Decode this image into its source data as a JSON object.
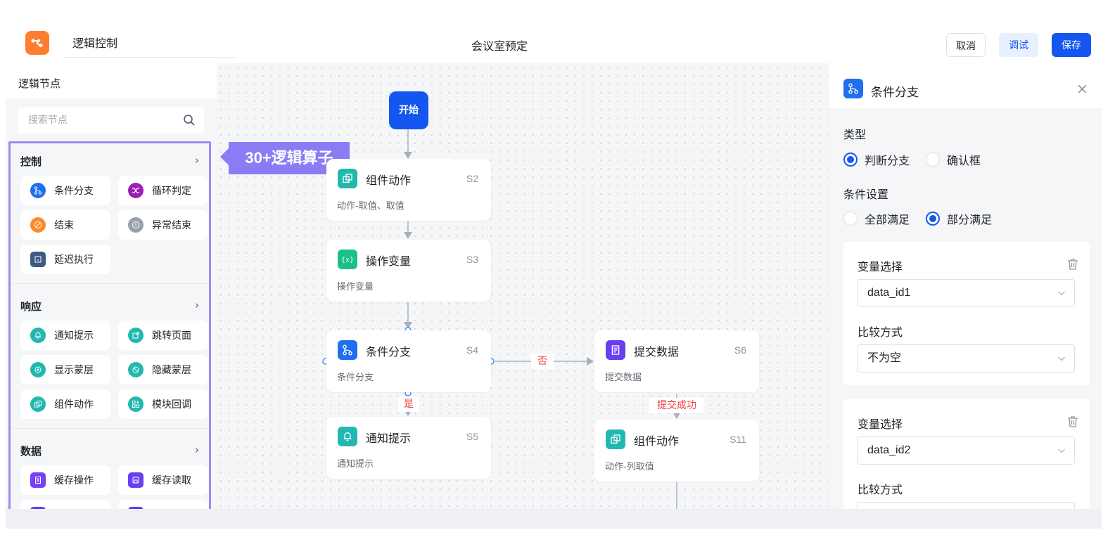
{
  "header": {
    "app_title": "逻辑控制",
    "page_title": "会议室预定",
    "buttons": {
      "cancel": "取消",
      "debug": "调试",
      "save": "保存"
    }
  },
  "sidebar": {
    "title": "逻辑节点",
    "search_placeholder": "搜索节点",
    "groups": [
      {
        "title": "控制",
        "items": [
          {
            "label": "条件分支",
            "icon": "branch-icon",
            "color": "#1f6ff0"
          },
          {
            "label": "循环判定",
            "icon": "loop-icon",
            "color": "#9b1fb4"
          },
          {
            "label": "结束",
            "icon": "end-icon",
            "color": "#ff8a2a"
          },
          {
            "label": "异常结束",
            "icon": "exception-icon",
            "color": "#9aa0a8"
          },
          {
            "label": "延迟执行",
            "icon": "delay-icon",
            "color": "#3d5a80"
          }
        ]
      },
      {
        "title": "响应",
        "items": [
          {
            "label": "通知提示",
            "icon": "bell-icon",
            "color": "#22b8b0"
          },
          {
            "label": "跳转页面",
            "icon": "redirect-icon",
            "color": "#22b8b0"
          },
          {
            "label": "显示蒙层",
            "icon": "show-mask-icon",
            "color": "#22b8b0"
          },
          {
            "label": "隐藏蒙层",
            "icon": "hide-mask-icon",
            "color": "#22b8b0"
          },
          {
            "label": "组件动作",
            "icon": "component-icon",
            "color": "#22b8b0"
          },
          {
            "label": "模块回调",
            "icon": "module-icon",
            "color": "#22b8b0"
          }
        ]
      },
      {
        "title": "数据",
        "items": [
          {
            "label": "缓存操作",
            "icon": "cache-op-icon",
            "color": "#7b3ff2"
          },
          {
            "label": "缓存读取",
            "icon": "cache-read-icon",
            "color": "#6a3ff2"
          }
        ]
      }
    ]
  },
  "callout": "30+逻辑算子",
  "flow": {
    "start": "开始",
    "nodes": [
      {
        "key": "s2",
        "title": "组件动作",
        "id": "S2",
        "desc": "动作-取值、取值",
        "icon": "component-icon",
        "color": "#22b8b0"
      },
      {
        "key": "s3",
        "title": "操作变量",
        "id": "S3",
        "desc": "操作变量",
        "icon": "variable-icon",
        "color": "#19c08a"
      },
      {
        "key": "s4",
        "title": "条件分支",
        "id": "S4",
        "desc": "条件分支",
        "icon": "branch-icon",
        "color": "#1f6ff0"
      },
      {
        "key": "s5",
        "title": "通知提示",
        "id": "S5",
        "desc": "通知提示",
        "icon": "bell-icon",
        "color": "#22b8b0"
      },
      {
        "key": "s6",
        "title": "提交数据",
        "id": "S6",
        "desc": "提交数据",
        "icon": "submit-icon",
        "color": "#6a3ff2"
      },
      {
        "key": "s11",
        "title": "组件动作",
        "id": "S11",
        "desc": "动作-列取值",
        "icon": "component-icon",
        "color": "#22b8b0"
      }
    ],
    "edge_labels": {
      "no": "否",
      "yes": "是",
      "submit_success": "提交成功"
    }
  },
  "panel": {
    "title": "条件分支",
    "type_label": "类型",
    "type_options": [
      "判断分支",
      "确认框"
    ],
    "type_selected": "判断分支",
    "condition_label": "条件设置",
    "condition_options": [
      "全部满足",
      "部分满足"
    ],
    "condition_selected": "部分满足",
    "cards": [
      {
        "variable_label": "变量选择",
        "variable_value": "data_id1",
        "compare_label": "比较方式",
        "compare_value": "不为空"
      },
      {
        "variable_label": "变量选择",
        "variable_value": "data_id2",
        "compare_label": "比较方式",
        "compare_value": ""
      }
    ]
  },
  "colors": {
    "primary": "#1456f0",
    "accent": "#8b7cf6",
    "edge_label": "#f53f3f"
  }
}
